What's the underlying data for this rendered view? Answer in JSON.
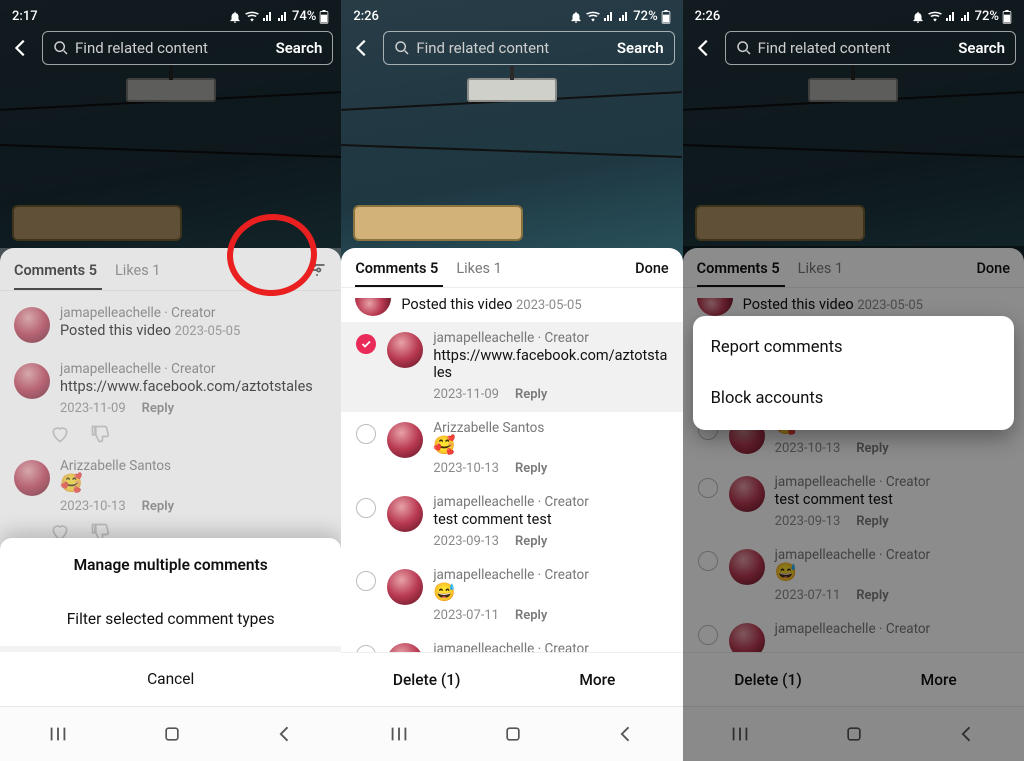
{
  "status": {
    "col1_time": "2:17",
    "col2_time": "2:26",
    "col3_time": "2:26",
    "col1_batt": "74%",
    "col2_batt": "72%",
    "col3_batt": "72%"
  },
  "search": {
    "placeholder": "Find related content",
    "button": "Search"
  },
  "tabs": {
    "comments": "Comments 5",
    "likes": "Likes 1",
    "done": "Done"
  },
  "posted": {
    "label": "Posted this video",
    "date": "2023-05-05"
  },
  "comments": [
    {
      "user": "jamapelleachelle",
      "role": "Creator",
      "text": "https://www.facebook.com/aztotstales",
      "date": "2023-11-09",
      "reply": "Reply",
      "emoji": ""
    },
    {
      "user": "Arizzabelle Santos",
      "role": "",
      "text": "",
      "date": "2023-10-13",
      "reply": "Reply",
      "emoji": "🥰"
    },
    {
      "user": "jamapelleachelle",
      "role": "Creator",
      "text": "test comment test",
      "date": "2023-09-13",
      "reply": "Reply",
      "emoji": ""
    },
    {
      "user": "jamapelleachelle",
      "role": "Creator",
      "text": "",
      "date": "2023-07-11",
      "reply": "Reply",
      "emoji": "😅"
    },
    {
      "user": "jamapelleachelle",
      "role": "Creator",
      "text": "",
      "date": "",
      "reply": "",
      "emoji": ""
    }
  ],
  "col1_sheet": {
    "item1": "Manage multiple comments",
    "item2": "Filter selected comment types",
    "cancel": "Cancel"
  },
  "bar": {
    "delete": "Delete (1)",
    "more": "More"
  },
  "popup": {
    "report": "Report comments",
    "block": "Block accounts"
  },
  "creator_with_role": "jamapelleachelle · Creator"
}
